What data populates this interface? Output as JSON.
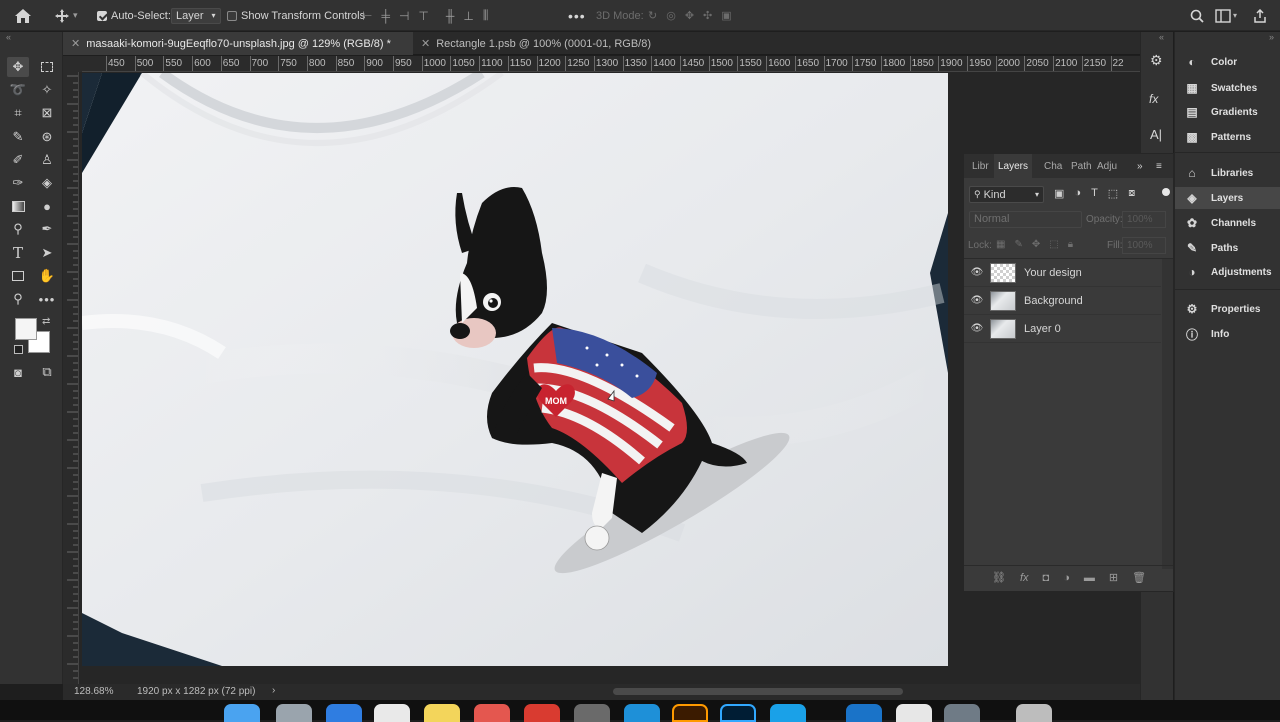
{
  "options_bar": {
    "auto_select_label": "Auto-Select:",
    "auto_select_value": "Layer",
    "transform_controls_label": "Show Transform Controls",
    "mode_3d_label": "3D Mode:"
  },
  "tabs": [
    {
      "label": "masaaki-komori-9ugEeqflo70-unsplash.jpg @ 129% (RGB/8) *"
    },
    {
      "label": "Rectangle 1.psb @ 100% (0001-01, RGB/8)"
    }
  ],
  "ruler_ticks": [
    "450",
    "500",
    "550",
    "600",
    "650",
    "700",
    "750",
    "800",
    "850",
    "900",
    "950",
    "1000",
    "1050",
    "1100",
    "1150",
    "1200",
    "1250",
    "1300",
    "1350",
    "1400",
    "1450",
    "1500",
    "1550",
    "1600",
    "1650",
    "1700",
    "1750",
    "1800",
    "1850",
    "1900",
    "1950",
    "2000",
    "2050",
    "2100",
    "2150",
    "22"
  ],
  "status": {
    "zoom": "128.68%",
    "dimensions": "1920 px x 1282 px (72 ppi)"
  },
  "canvas_art": {
    "heart_text": "MOM"
  },
  "layers_panel": {
    "tabs": [
      "Libr",
      "Layers",
      "Cha",
      "Path",
      "Adju"
    ],
    "filter_kind": "Kind",
    "blend_mode": "Normal",
    "opacity_label": "Opacity:",
    "opacity_value": "100%",
    "lock_label": "Lock:",
    "fill_label": "Fill:",
    "fill_value": "100%",
    "layers": [
      {
        "name": "Your design"
      },
      {
        "name": "Background"
      },
      {
        "name": "Layer 0"
      }
    ]
  },
  "right_dock": {
    "items": [
      {
        "label": "Color",
        "icon": "color-icon"
      },
      {
        "label": "Swatches",
        "icon": "swatches-icon"
      },
      {
        "label": "Gradients",
        "icon": "gradients-icon"
      },
      {
        "label": "Patterns",
        "icon": "patterns-icon"
      },
      {
        "label": "Libraries",
        "icon": "libraries-icon"
      },
      {
        "label": "Layers",
        "icon": "layers-icon"
      },
      {
        "label": "Channels",
        "icon": "channels-icon"
      },
      {
        "label": "Paths",
        "icon": "paths-icon"
      },
      {
        "label": "Adjustments",
        "icon": "adjustments-icon"
      },
      {
        "label": "Properties",
        "icon": "properties-icon"
      },
      {
        "label": "Info",
        "icon": "info-icon"
      }
    ]
  },
  "colors": {
    "app_bg": "#323232",
    "panel_bg": "#3a3a3a",
    "accent": "#2d8ceb"
  }
}
